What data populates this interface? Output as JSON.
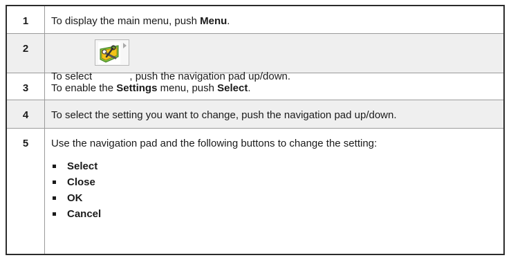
{
  "steps": [
    {
      "num": "1",
      "before": "To display the main menu, push ",
      "bold": "Menu",
      "after": "."
    },
    {
      "num": "2",
      "before": "To select ",
      "icon": "settings-tools-icon",
      "after": ", push the navigation pad up/down."
    },
    {
      "num": "3",
      "before": "To enable the ",
      "bold": "Settings",
      "middle": " menu, push ",
      "bold2": "Select",
      "after": "."
    },
    {
      "num": "4",
      "text": "To select the setting you want to change, push the navigation pad up/down."
    },
    {
      "num": "5",
      "text": "Use the navigation pad and the following buttons to change the setting:",
      "bullets": [
        "Select",
        "Close",
        "OK",
        "Cancel"
      ]
    }
  ],
  "colors": {
    "border": "#2b2b2b",
    "divider": "#9a9a9a",
    "shade": "#efefef",
    "icon_green": "#7cc242",
    "icon_yellow": "#f2c318"
  }
}
